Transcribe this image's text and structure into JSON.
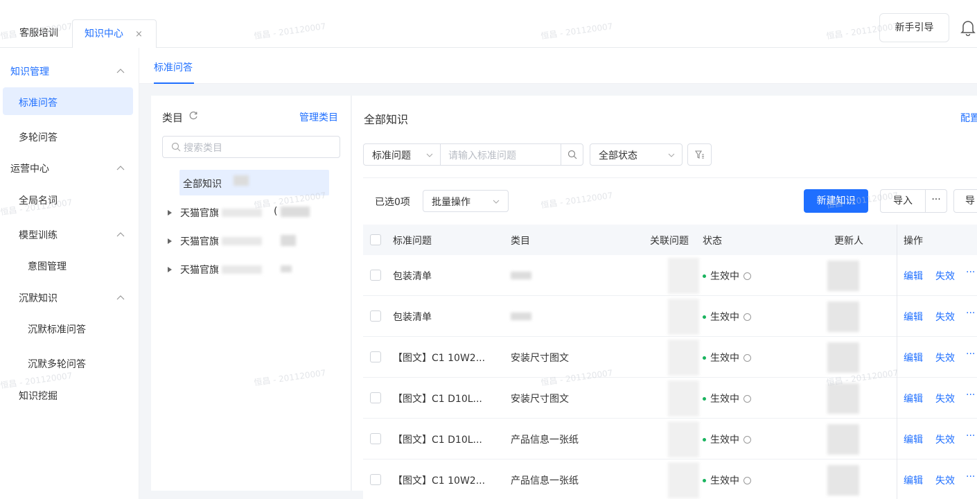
{
  "topbar": {
    "tabs": [
      {
        "label": "客服培训"
      },
      {
        "label": "知识中心",
        "close": "×"
      }
    ],
    "guide_button": "新手引导",
    "icons": {
      "notifications": "bell-icon"
    }
  },
  "sidenav": {
    "groups": [
      {
        "label": "知识管理",
        "items": [
          "标准问答",
          "多轮问答"
        ]
      },
      {
        "label": "运营中心",
        "items": [
          "全局名词",
          "模型训练",
          "意图管理",
          "沉默知识",
          "沉默标准问答",
          "沉默多轮问答",
          "知识挖掘"
        ]
      }
    ]
  },
  "subheader": {
    "tab": "标准问答"
  },
  "category_panel": {
    "title": "类目",
    "manage_link": "管理类目",
    "search_placeholder": "搜索类目",
    "all_label": "全部知识",
    "nodes": [
      "天猫官旗",
      "天猫官旗",
      "天猫官旗"
    ],
    "node_suffix": "("
  },
  "main": {
    "title": "全部知识",
    "config_link": "配置",
    "filters": {
      "question_type": "标准问题",
      "question_placeholder": "请输入标准问题",
      "status": "全部状态"
    },
    "selected_count": "已选0项",
    "batch_label": "批量操作",
    "new_button": "新建知识",
    "import_button": "导入",
    "more_button": "···",
    "export_button": "导",
    "table": {
      "headers": [
        "标准问题",
        "类目",
        "关联问题",
        "状态",
        "更新人",
        "操作"
      ],
      "rows": [
        {
          "question": "包装清单",
          "category": "",
          "status": "生效中"
        },
        {
          "question": "包装清单",
          "category": "",
          "status": "生效中"
        },
        {
          "question": "【图文】C1 10W2...",
          "category": "安装尺寸图文",
          "status": "生效中"
        },
        {
          "question": "【图文】C1 D10L...",
          "category": "安装尺寸图文",
          "status": "生效中"
        },
        {
          "question": "【图文】C1 D10L...",
          "category": "产品信息一张纸",
          "status": "生效中"
        },
        {
          "question": "【图文】C1 10W2...",
          "category": "产品信息一张纸",
          "status": "生效中"
        }
      ],
      "actions": {
        "edit": "编辑",
        "disable": "失效",
        "more": "···"
      }
    }
  },
  "watermark": "恒昌 - 201120007",
  "colors": {
    "accent": "#1f6fff",
    "active_bg": "#e6efff",
    "status_green": "#19b35e",
    "page_bg": "#f3f5f8"
  }
}
